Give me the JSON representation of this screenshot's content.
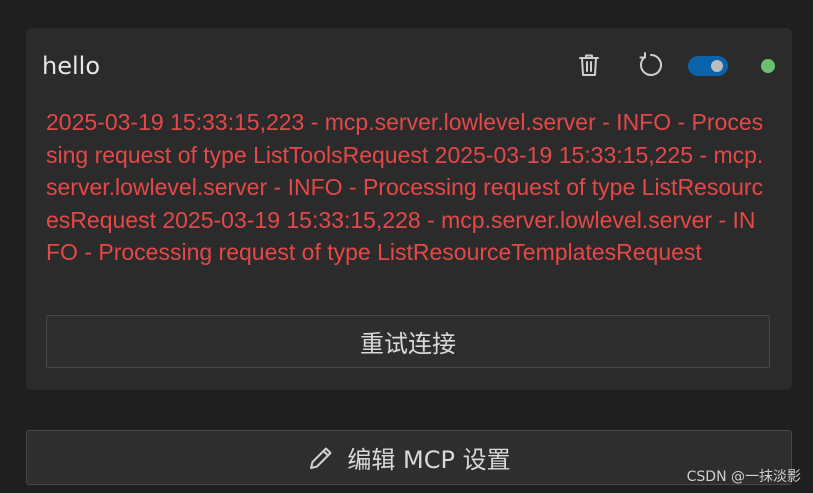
{
  "server": {
    "name": "hello",
    "status_color": "#6cc070",
    "enabled": true,
    "log_color": "#e54848",
    "log": "2025-03-19 15:33:15,223 - mcp.server.lowlevel.server - INFO - Processing request of type ListToolsRequest 2025-03-19 15:33:15,225 - mcp.server.lowlevel.server - INFO - Processing request of type ListResourcesRequest 2025-03-19 15:33:15,228 - mcp.server.lowlevel.server - INFO - Processing request of type ListResourceTemplatesRequest",
    "retry_label": "重试连接",
    "icons": {
      "delete": "trash-icon",
      "refresh": "refresh-icon"
    }
  },
  "edit_settings": {
    "label": "编辑 MCP 设置",
    "icon": "pencil-icon"
  },
  "watermark": "CSDN @一抹淡影"
}
